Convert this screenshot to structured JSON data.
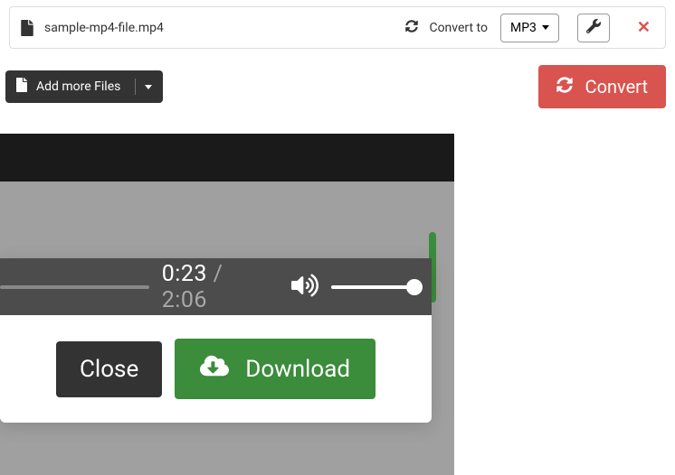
{
  "file": {
    "name": "sample-mp4-file.mp4",
    "convert_to_label": "Convert to",
    "format_selected": "MP3"
  },
  "toolbar": {
    "add_more_label": "Add more Files",
    "convert_label": "Convert"
  },
  "player": {
    "current_time": "0:23",
    "total_time": "2:06",
    "separator": " / "
  },
  "modal": {
    "close_label": "Close",
    "download_label": "Download"
  }
}
